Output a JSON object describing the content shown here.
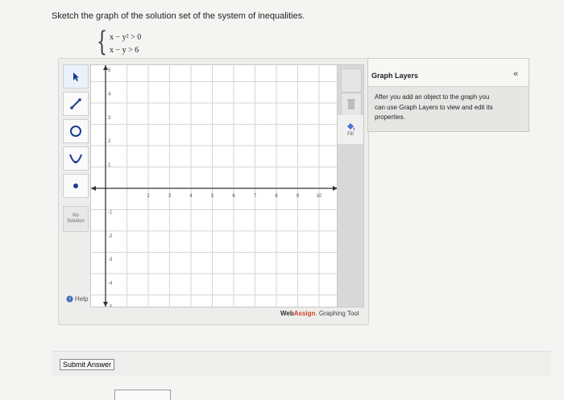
{
  "question": {
    "prompt": "Sketch the graph of the solution set of the system of inequalities.",
    "inequality_1": "x − y² > 0",
    "inequality_2": "x − y > 6"
  },
  "toolbar": {
    "icons": [
      "pointer-icon",
      "line-icon",
      "circle-icon",
      "parabola-icon",
      "point-icon"
    ],
    "no_solution_line1": "No",
    "no_solution_line2": "Solution",
    "help_label": "Help"
  },
  "graph": {
    "x_ticks": [
      "2",
      "3",
      "4",
      "5",
      "6",
      "7",
      "8",
      "9",
      "10"
    ],
    "y_ticks": [
      "5",
      "4",
      "3",
      "2",
      "1",
      "-1",
      "-2",
      "-3",
      "-4",
      "-5"
    ]
  },
  "right_tools": {
    "fill_label": "Fill"
  },
  "branding": {
    "web": "Web",
    "assign": "Assign",
    "suffix": ". Graphing Tool"
  },
  "layers": {
    "title": "Graph Layers",
    "collapse_icon": "«",
    "line1": "After you add an object to the graph you",
    "line2": "can use Graph Layers to view and edit its",
    "line3": "properties."
  },
  "submit": {
    "label": "Submit Answer"
  }
}
